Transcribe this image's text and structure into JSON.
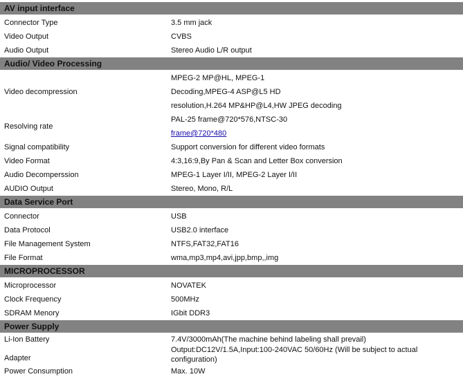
{
  "sections": [
    {
      "title": "AV input interface",
      "rows": [
        {
          "label": "Connector Type",
          "lines": [
            "3.5 mm jack"
          ]
        },
        {
          "label": "Video Output",
          "lines": [
            "CVBS"
          ]
        },
        {
          "label": "Audio Output",
          "lines": [
            "Stereo Audio L/R output"
          ]
        }
      ]
    },
    {
      "title": "Audio/ Video Processing",
      "rows": [
        {
          "label": "Video decompression",
          "lines": [
            "MPEG-2 MP@HL, MPEG-1",
            "Decoding,MPEG-4 ASP@L5 HD",
            "resolution,H.264 MP&HP@L4,HW JPEG decoding"
          ]
        },
        {
          "label": "Resolving rate",
          "lines": [
            "PAL-25 frame@720*576,NTSC-30"
          ],
          "link": "frame@720*480"
        },
        {
          "label": "Signal compatibility",
          "lines": [
            "Support conversion for different video formats"
          ]
        },
        {
          "label": "Video Format",
          "lines": [
            "4:3,16:9,By Pan & Scan and Letter Box conversion"
          ]
        },
        {
          "label": "Audio Decomperssion",
          "lines": [
            "MPEG-1 Layer I/II, MPEG-2 Layer I/II"
          ]
        },
        {
          "label": "AUDIO Output",
          "lines": [
            "Stereo, Mono, R/L"
          ]
        }
      ]
    },
    {
      "title": "Data Service Port",
      "rows": [
        {
          "label": "Connector",
          "lines": [
            "USB"
          ]
        },
        {
          "label": "Data Protocol",
          "lines": [
            "USB2.0 interface"
          ]
        },
        {
          "label": "File Management System",
          "lines": [
            "NTFS,FAT32,FAT16"
          ]
        },
        {
          "label": "File Format",
          "lines": [
            "wma,mp3,mp4,avi,jpp,bmp,,img"
          ]
        }
      ]
    },
    {
      "title": "MICROPROCESSOR",
      "rows": [
        {
          "label": "Microprocessor",
          "lines": [
            "NOVATEK"
          ]
        },
        {
          "label": "Clock Frequency",
          "lines": [
            "500MHz"
          ]
        },
        {
          "label": "SDRAM Menory",
          "lines": [
            "IGbit DDR3"
          ]
        }
      ]
    },
    {
      "title": "Power Supply",
      "rows": [
        {
          "label": "Li-Ion Battery",
          "lines": [
            "7.4V/3000mAh(The machine behind labeling shall prevail)"
          ],
          "tight": true
        },
        {
          "label": "Adapter",
          "lines": [
            "Output:DC12V/1.5A,Input:100-240VAC 50/60Hz (Will be subject to actual",
            "configuration)"
          ],
          "tight": true,
          "align": "bottom"
        },
        {
          "label": "Power Consumption",
          "lines": [
            "Max. 10W"
          ]
        }
      ]
    }
  ]
}
